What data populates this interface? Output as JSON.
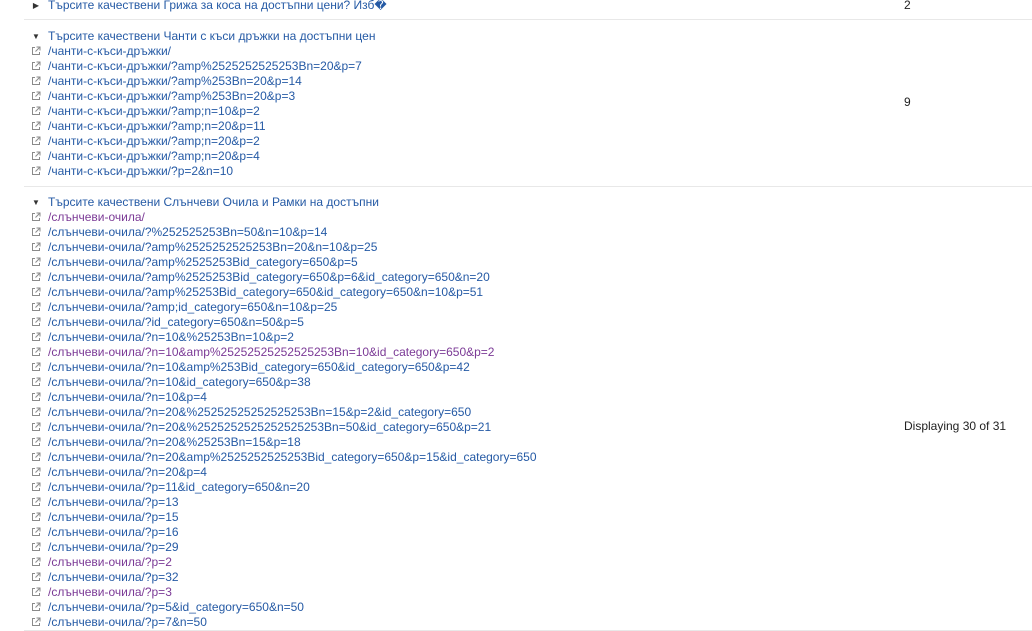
{
  "groups": [
    {
      "title": "Търсите качествени Грижа за коса на достъпни цени? Изб�",
      "expanded": false,
      "count": "2",
      "urls": []
    },
    {
      "title": "Търсите качествени Чанти с къси дръжки на достъпни цен",
      "expanded": true,
      "count": "9",
      "urls": [
        {
          "text": "/чанти-с-къси-дръжки/",
          "visited": false
        },
        {
          "text": "/чанти-с-къси-дръжки/?amp%2525252525253Bn=20&p=7",
          "visited": false
        },
        {
          "text": "/чанти-с-къси-дръжки/?amp%253Bn=20&p=14",
          "visited": false
        },
        {
          "text": "/чанти-с-къси-дръжки/?amp%253Bn=20&p=3",
          "visited": false
        },
        {
          "text": "/чанти-с-къси-дръжки/?amp;n=10&p=2",
          "visited": false
        },
        {
          "text": "/чанти-с-къси-дръжки/?amp;n=20&p=11",
          "visited": false
        },
        {
          "text": "/чанти-с-къси-дръжки/?amp;n=20&p=2",
          "visited": false
        },
        {
          "text": "/чанти-с-къси-дръжки/?amp;n=20&p=4",
          "visited": false
        },
        {
          "text": "/чанти-с-къси-дръжки/?p=2&n=10",
          "visited": false
        }
      ]
    },
    {
      "title": "Търсите качествени Слънчеви Очила и Рамки на достъпни",
      "expanded": true,
      "count": "Displaying 30 of 31",
      "urls": [
        {
          "text": "/слънчеви-очила/",
          "visited": true
        },
        {
          "text": "/слънчеви-очила/?%252525253Bn=50&n=10&p=14",
          "visited": false
        },
        {
          "text": "/слънчеви-очила/?amp%2525252525253Bn=20&n=10&p=25",
          "visited": false
        },
        {
          "text": "/слънчеви-очила/?amp%2525253Bid_category=650&p=5",
          "visited": false
        },
        {
          "text": "/слънчеви-очила/?amp%2525253Bid_category=650&p=6&id_category=650&n=20",
          "visited": false
        },
        {
          "text": "/слънчеви-очила/?amp%25253Bid_category=650&id_category=650&n=10&p=51",
          "visited": false
        },
        {
          "text": "/слънчеви-очила/?amp;id_category=650&n=10&p=25",
          "visited": false
        },
        {
          "text": "/слънчеви-очила/?id_category=650&n=50&p=5",
          "visited": false
        },
        {
          "text": "/слънчеви-очила/?n=10&%25253Bn=10&p=2",
          "visited": false
        },
        {
          "text": "/слънчеви-очила/?n=10&amp%25252525252525253Bn=10&id_category=650&p=2",
          "visited": true
        },
        {
          "text": "/слънчеви-очила/?n=10&amp%253Bid_category=650&id_category=650&p=42",
          "visited": false
        },
        {
          "text": "/слънчеви-очила/?n=10&id_category=650&p=38",
          "visited": false
        },
        {
          "text": "/слънчеви-очила/?n=10&p=4",
          "visited": false
        },
        {
          "text": "/слънчеви-очила/?n=20&%25252525252525253Bn=15&p=2&id_category=650",
          "visited": false
        },
        {
          "text": "/слънчеви-очила/?n=20&%2525252525252525253Bn=50&id_category=650&p=21",
          "visited": false
        },
        {
          "text": "/слънчеви-очила/?n=20&%25253Bn=15&p=18",
          "visited": false
        },
        {
          "text": "/слънчеви-очила/?n=20&amp%2525252525253Bid_category=650&p=15&id_category=650",
          "visited": false
        },
        {
          "text": "/слънчеви-очила/?n=20&p=4",
          "visited": false
        },
        {
          "text": "/слънчеви-очила/?p=11&id_category=650&n=20",
          "visited": false
        },
        {
          "text": "/слънчеви-очила/?p=13",
          "visited": false
        },
        {
          "text": "/слънчеви-очила/?p=15",
          "visited": false
        },
        {
          "text": "/слънчеви-очила/?p=16",
          "visited": false
        },
        {
          "text": "/слънчеви-очила/?p=29",
          "visited": false
        },
        {
          "text": "/слънчеви-очила/?p=2",
          "visited": true
        },
        {
          "text": "/слънчеви-очила/?p=32",
          "visited": false
        },
        {
          "text": "/слънчеви-очила/?p=3",
          "visited": true
        },
        {
          "text": "/слънчеви-очила/?p=5&id_category=650&n=50",
          "visited": false
        },
        {
          "text": "/слънчеви-очила/?p=7&n=50",
          "visited": false
        }
      ]
    }
  ]
}
